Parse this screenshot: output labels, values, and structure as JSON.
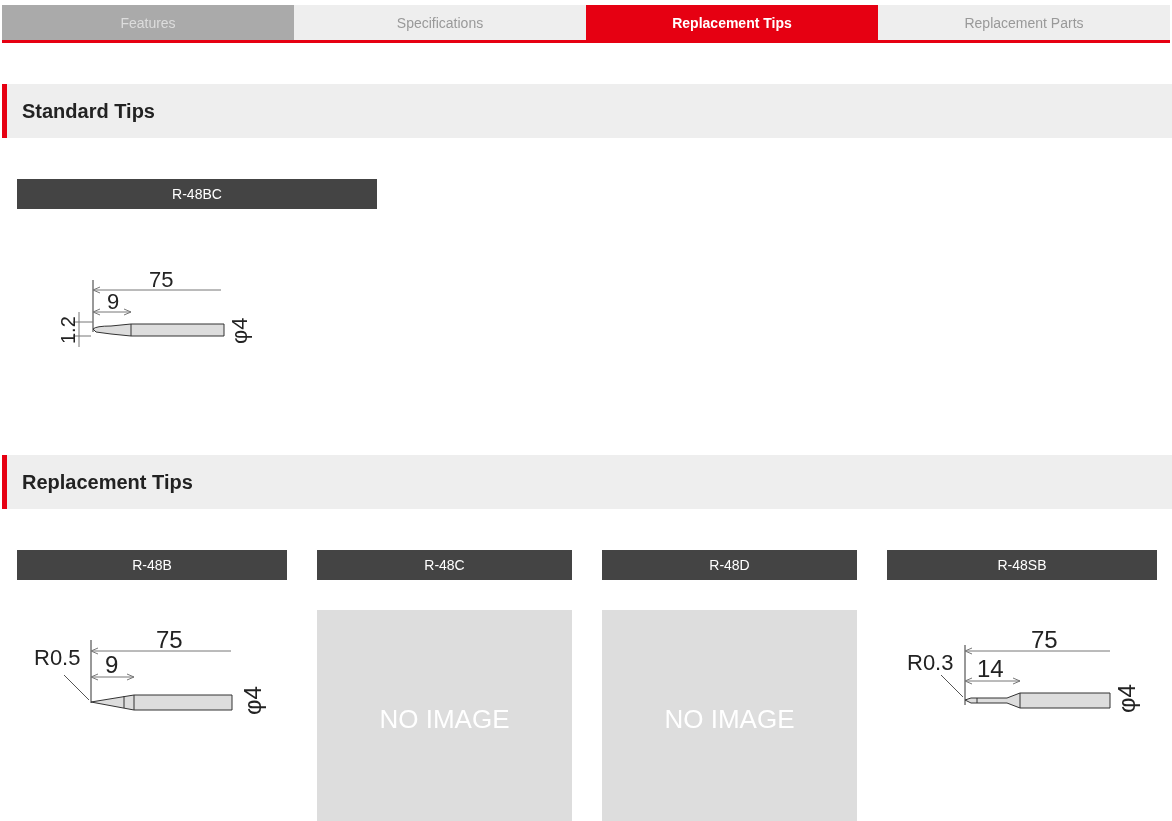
{
  "tabs": [
    {
      "label": "Features",
      "selected": false,
      "highlighted": true
    },
    {
      "label": "Specifications",
      "selected": false,
      "highlighted": false
    },
    {
      "label": "Replacement Tips",
      "selected": true,
      "highlighted": false
    },
    {
      "label": "Replacement Parts",
      "selected": false,
      "highlighted": false
    }
  ],
  "sections": [
    {
      "title": "Standard Tips",
      "tips": [
        {
          "name": "R-48BC",
          "image": {
            "kind": "bevel",
            "length": "75",
            "taper": "9",
            "tip": "1.2",
            "diameter": "φ4"
          }
        }
      ]
    },
    {
      "title": "Replacement Tips",
      "tips": [
        {
          "name": "R-48B",
          "image": {
            "kind": "conical",
            "length": "75",
            "taper": "9",
            "tip": "R0.5",
            "diameter": "φ4"
          }
        },
        {
          "name": "R-48C",
          "image": {
            "kind": "none",
            "text": "NO IMAGE"
          }
        },
        {
          "name": "R-48D",
          "image": {
            "kind": "none",
            "text": "NO IMAGE"
          }
        },
        {
          "name": "R-48SB",
          "image": {
            "kind": "needle",
            "length": "75",
            "taper": "14",
            "tip": "R0.3",
            "diameter": "φ4"
          }
        }
      ]
    }
  ]
}
